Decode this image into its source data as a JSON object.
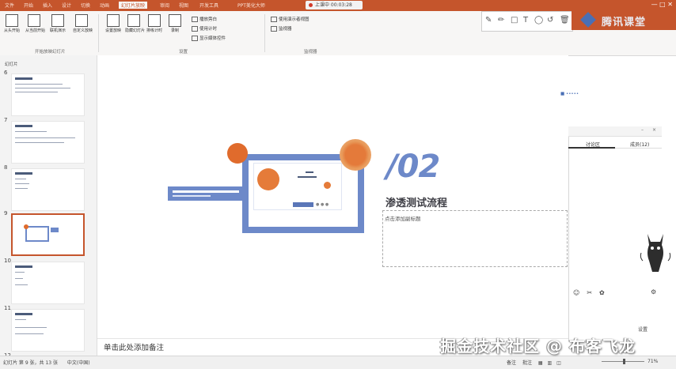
{
  "titlebar": {
    "tabs": [
      "文件",
      "开始",
      "插入",
      "设计",
      "切换",
      "动画",
      "幻灯片放映",
      "审阅",
      "视图",
      "开发工具",
      "PPT美化大师"
    ],
    "active_tab": "动画",
    "recording_label": "上课中 00:03:28"
  },
  "ribbon": {
    "buttons": [
      "从头开始",
      "从当前开始",
      "联机演示",
      "自定义放映",
      "设置放映",
      "隐藏幻灯片",
      "排练计时",
      "录制"
    ],
    "options": [
      "播放旁白",
      "使用计时",
      "显示媒体控件",
      "使用演示者视图",
      "监视器"
    ],
    "groups": [
      "开始放映幻灯片",
      "设置",
      "监视器"
    ]
  },
  "brand": {
    "name": "腾讯课堂"
  },
  "slides_pane": {
    "label": "幻灯片",
    "numbers": [
      "6",
      "7",
      "8",
      "9",
      "10",
      "11",
      "12"
    ],
    "selected": "9"
  },
  "slide": {
    "number": "/02",
    "title": "渗透测试流程",
    "placeholder": "点击添加副标题"
  },
  "notes": {
    "placeholder": "单击此处添加备注"
  },
  "right_panel": {
    "tab_discussion": "讨论区",
    "tab_members": "成员(12)",
    "footer_label": "设置"
  },
  "statusbar": {
    "left": "幻灯片 第 9 张，共 13 张",
    "language": "中文(中国)",
    "right_items": [
      "备注",
      "批注"
    ],
    "zoom": "71%"
  },
  "watermark": "掘金技术社区 @ 布客飞龙"
}
